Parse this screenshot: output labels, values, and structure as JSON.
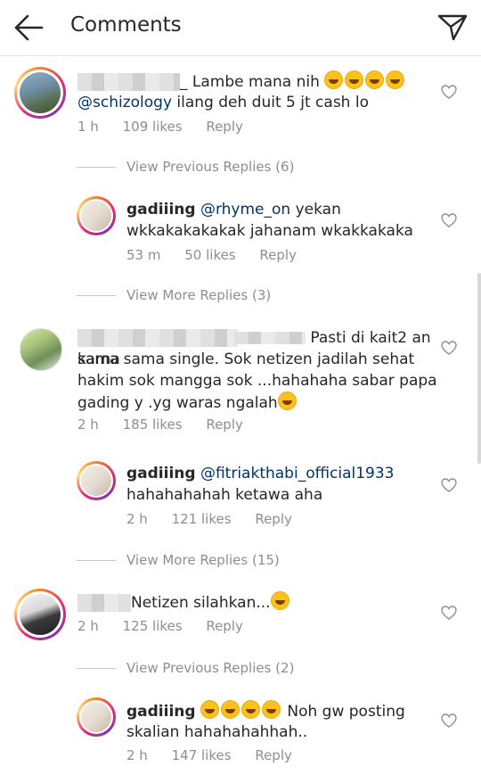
{
  "header": {
    "title": "Comments",
    "back_icon": "arrow-left-icon",
    "send_icon": "paper-plane-icon"
  },
  "comments": [
    {
      "text_prefix": "_ Lambe mana nih",
      "text_line2_mention": "@schizology",
      "text_line2": " ilang deh duit 5 jt cash lo",
      "time": "1 h",
      "likes": "109 likes",
      "reply": "Reply",
      "view_more": "View Previous Replies (6)",
      "reply_item": {
        "username": "gadiiing",
        "mention": "@rhyme_on",
        "text_line1": " yekan",
        "text_line2": "wkkakakakakak jahanam wkakkakaka",
        "time": "53 m",
        "likes": "50 likes",
        "reply": "Reply"
      },
      "view_more_after": "View More Replies (3)"
    },
    {
      "line1": "Pasti di kait2 an karna",
      "line2": "sama sama single. Sok netizen jadilah sehat",
      "line3": "hakim sok mangga sok ...hahahaha sabar papa",
      "line4": "gading y .yg waras ngalah",
      "time": "2 h",
      "likes": "185 likes",
      "reply": "Reply",
      "reply_item": {
        "username": "gadiiing",
        "mention": "@fitriakthabi_official1933",
        "text_line2": "hahahahahah ketawa aha",
        "time": "2 h",
        "likes": "121 likes",
        "reply": "Reply"
      },
      "view_more": "View More Replies (15)"
    },
    {
      "text": "Netizen silahkan...",
      "time": "2 h",
      "likes": "125 likes",
      "reply": "Reply",
      "view_more": "View Previous Replies (2)",
      "reply_item": {
        "username": "gadiiing",
        "text_line1": "Noh gw posting",
        "text_line2": "skalian hahahahahhah..",
        "time": "2 h",
        "likes": "147 likes",
        "reply": "Reply"
      }
    }
  ]
}
